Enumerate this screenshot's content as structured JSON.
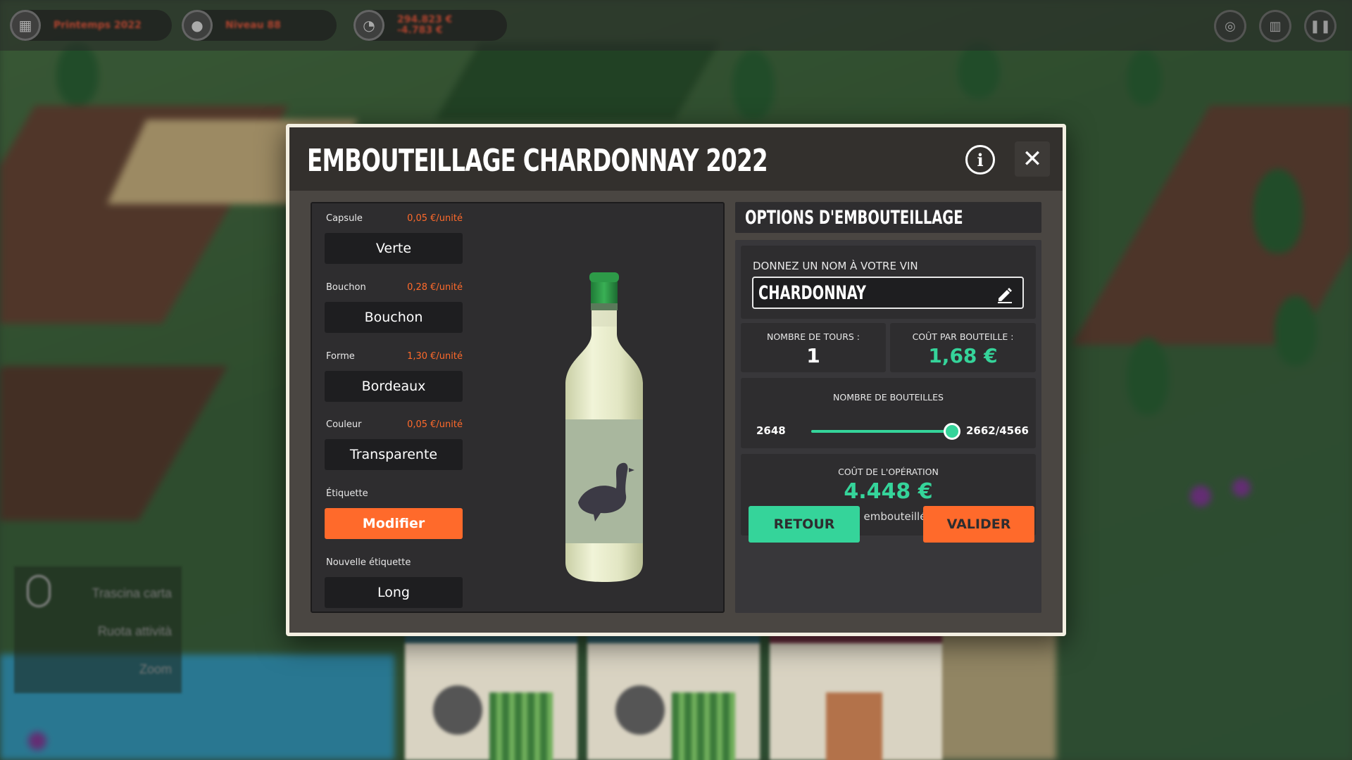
{
  "hud": {
    "season": "Printemps 2022",
    "level": "Niveau 88",
    "money": "294.823 €",
    "money_delta": "-4.783 €"
  },
  "controls": {
    "drag": "Trascina carta",
    "rotate": "Ruota attività",
    "zoom": "Zoom"
  },
  "modal": {
    "title": "EMBOUTEILLAGE CHARDONNAY 2022",
    "options": [
      {
        "label": "Capsule",
        "price": "0,05 €/unité",
        "value": "Verte"
      },
      {
        "label": "Bouchon",
        "price": "0,28 €/unité",
        "value": "Bouchon"
      },
      {
        "label": "Forme",
        "price": "1,30 €/unité",
        "value": "Bordeaux"
      },
      {
        "label": "Couleur",
        "price": "0,05 €/unité",
        "value": "Transparente"
      },
      {
        "label": "Étiquette",
        "price": "",
        "value": "Modifier"
      },
      {
        "label": "Nouvelle étiquette",
        "price": "",
        "value": "Long"
      }
    ],
    "options_header": "OPTIONS D'EMBOUTEILLAGE",
    "name_label": "DONNEZ UN NOM À VOTRE VIN",
    "wine_name": "CHARDONNAY",
    "rounds_label": "NOMBRE DE TOURS :",
    "rounds_value": "1",
    "cost_per_bottle_label": "COÛT PAR BOUTEILLE :",
    "cost_per_bottle_value": "1,68 €",
    "bottles_label": "NOMBRE DE BOUTEILLES",
    "bottles_min": "2648",
    "bottles_max_text": "2662/4566",
    "bottles_slider_fraction": 1.0,
    "operation_cost_label": "COÛT DE L'OPÉRATION",
    "operation_cost_value": "4.448 €",
    "remaining_note": "Le vin restant sera embouteillé plus tard (1918)",
    "back_button": "RETOUR",
    "confirm_button": "VALIDER"
  },
  "colors": {
    "accent_orange": "#ff6a2b",
    "accent_green": "#35d49a",
    "panel_dark": "#2e2d2f",
    "modal_bg": "#4a4642",
    "header_bg": "#33302d"
  },
  "icons": {
    "info": "info-icon",
    "close": "close-icon",
    "edit": "pencil-icon",
    "bottle": "wine-bottle-duck-label"
  }
}
